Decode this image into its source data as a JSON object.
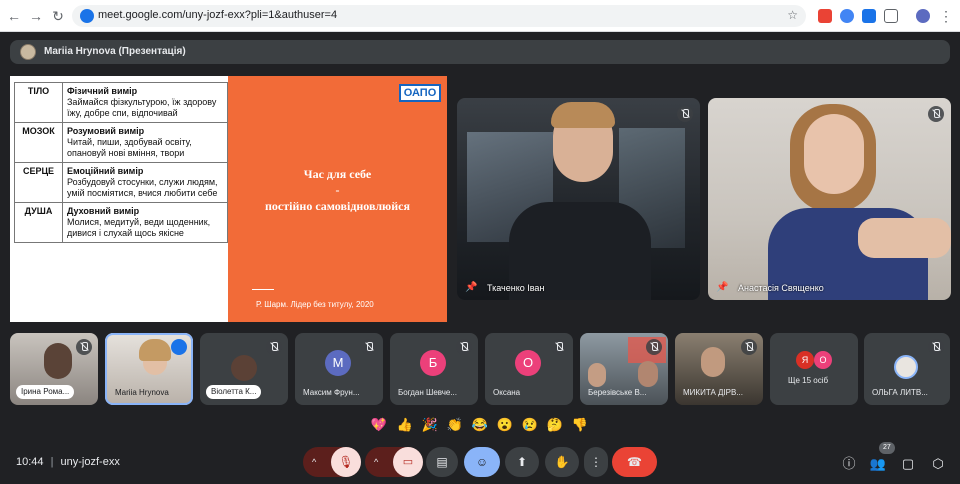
{
  "browser": {
    "url": "meet.google.com/uny-jozf-exx?pli=1&authuser=4"
  },
  "presentation": {
    "presenter_label": "Mariia Hrynova (Презентація)"
  },
  "slide": {
    "rows": [
      {
        "key": "ТІЛО",
        "head": "Фізичний вимір",
        "body": "Займайся фізкультурою, їж здорову їжу, добре спи, відпочивай"
      },
      {
        "key": "МОЗОК",
        "head": "Розумовий вимір",
        "body": "Читай, пиши, здобувай освіту, опановуй нові вміння, твори"
      },
      {
        "key": "СЕРЦЕ",
        "head": "Емоційний вимір",
        "body": "Розбудовуй стосунки, служи людям, умій посміятися, вчися любити себе"
      },
      {
        "key": "ДУША",
        "head": "Духовний вимір",
        "body": "Молися, медитуй, веди щоденник, дивися і слухай щось якісне"
      }
    ],
    "logo_text": "ОАПО",
    "main_line1": "Час для себе",
    "main_line2": "-",
    "main_line3": "постійно самовідновлюйся",
    "citation": "Р. Шарм. Лідер без титулу, 2020"
  },
  "big_tiles": [
    {
      "name": "Ткаченко Іван"
    },
    {
      "name": "Анастасія Священко"
    }
  ],
  "small_tiles": [
    {
      "name": "Ірина Рома..."
    },
    {
      "name": "Mariia Hrynova"
    },
    {
      "name": "Віолетта К..."
    },
    {
      "name": "Максим Фрун...",
      "initial": "М",
      "color": "#5c6bc0"
    },
    {
      "name": "Богдан Шевче...",
      "initial": "Б",
      "color": "#ec407a"
    },
    {
      "name": "Оксана",
      "initial": "О",
      "color": "#ec407a"
    },
    {
      "name": "Березівське В..."
    },
    {
      "name": "МИКИТА ДІРВ..."
    },
    {
      "name": "Ще 15 осіб",
      "initials": [
        "Я",
        "О"
      ]
    },
    {
      "name": "ОЛЬГА ЛИТВ..."
    }
  ],
  "reactions": [
    "💖",
    "👍",
    "🎉",
    "👏",
    "😂",
    "😮",
    "😢",
    "🤔",
    "👎"
  ],
  "bottom": {
    "time": "10:44",
    "separator": "|",
    "meeting_code": "uny-jozf-exx",
    "participants_count": "27"
  },
  "colors": {
    "background": "#202124",
    "tile": "#3c4043",
    "slide_accent": "#f26b38",
    "end_call": "#ea4335",
    "muted_red": "#f9dedc",
    "active_blue": "#8ab4f8"
  }
}
